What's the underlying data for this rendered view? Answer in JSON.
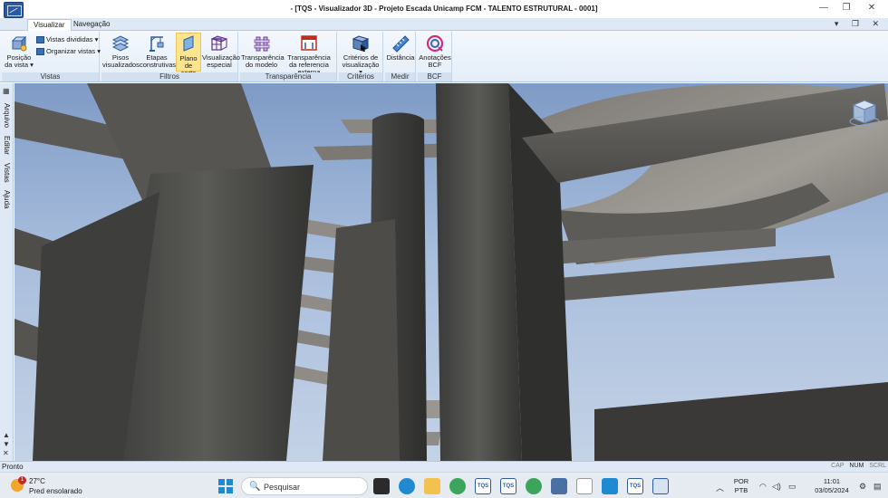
{
  "window": {
    "title": "- [TQS - Visualizador 3D - Projeto Escada Unicamp FCM - TALENTO ESTRUTURAL - 0001]",
    "min_glyph": "—",
    "max_glyph": "❐",
    "close_glyph": "✕"
  },
  "ribbon_tabs": [
    {
      "label": "Visualizar",
      "active": true
    },
    {
      "label": "Navegação",
      "active": false
    }
  ],
  "mdi_controls": "▾ ❐ ✕",
  "groups": {
    "vistas": {
      "label": "Vistas",
      "posicao": "Posição da vista",
      "posicao_arrow": "▾",
      "vistas_divididas": "Vistas divididas ▾",
      "organizar_vistas": "Organizar vistas ▾"
    },
    "filtros": {
      "label": "Filtros",
      "pisos": "Pisos visualizados",
      "etapas": "Etapas construtivas",
      "plano": "Plano de corte",
      "especial": "Visualização especial"
    },
    "transparencia": {
      "label": "Transparência",
      "modelo": "Transparência do modelo",
      "referencia": "Transparência da referencia externa"
    },
    "criterios": {
      "label": "Critérios",
      "criterios": "Critérios de visualização ▾"
    },
    "medir": {
      "label": "Medir",
      "distancia": "Distância"
    },
    "bcf": {
      "label": "BCF",
      "anotacoes": "Anotações BCF"
    }
  },
  "left_dock": {
    "items": [
      "Arquivo",
      "Editar",
      "Vistas",
      "Ajuda"
    ],
    "close_glyph": "✕"
  },
  "status": {
    "text": "Pronto",
    "indicators": [
      {
        "label": "CAP",
        "on": false
      },
      {
        "label": "NUM",
        "on": true
      },
      {
        "label": "SCRL",
        "on": false
      }
    ]
  },
  "taskbar": {
    "weather_temp": "27°C",
    "weather_cond": "Pred ensolarado",
    "notification_count": "1",
    "search_placeholder": "Pesquisar",
    "search_icon": "🔍",
    "apps": [
      "TQS",
      "TQS",
      "TQS"
    ],
    "language": "POR",
    "layout": "PTB",
    "time": "11:01",
    "date": "03/05/2024",
    "tray_chevron": "︿"
  },
  "colors": {
    "accent": "#2c5aa0",
    "highlight": "#fde58d",
    "ribbon": "#dfe9f5",
    "sky": "#a8bddc",
    "concrete": "#4a4a48"
  }
}
